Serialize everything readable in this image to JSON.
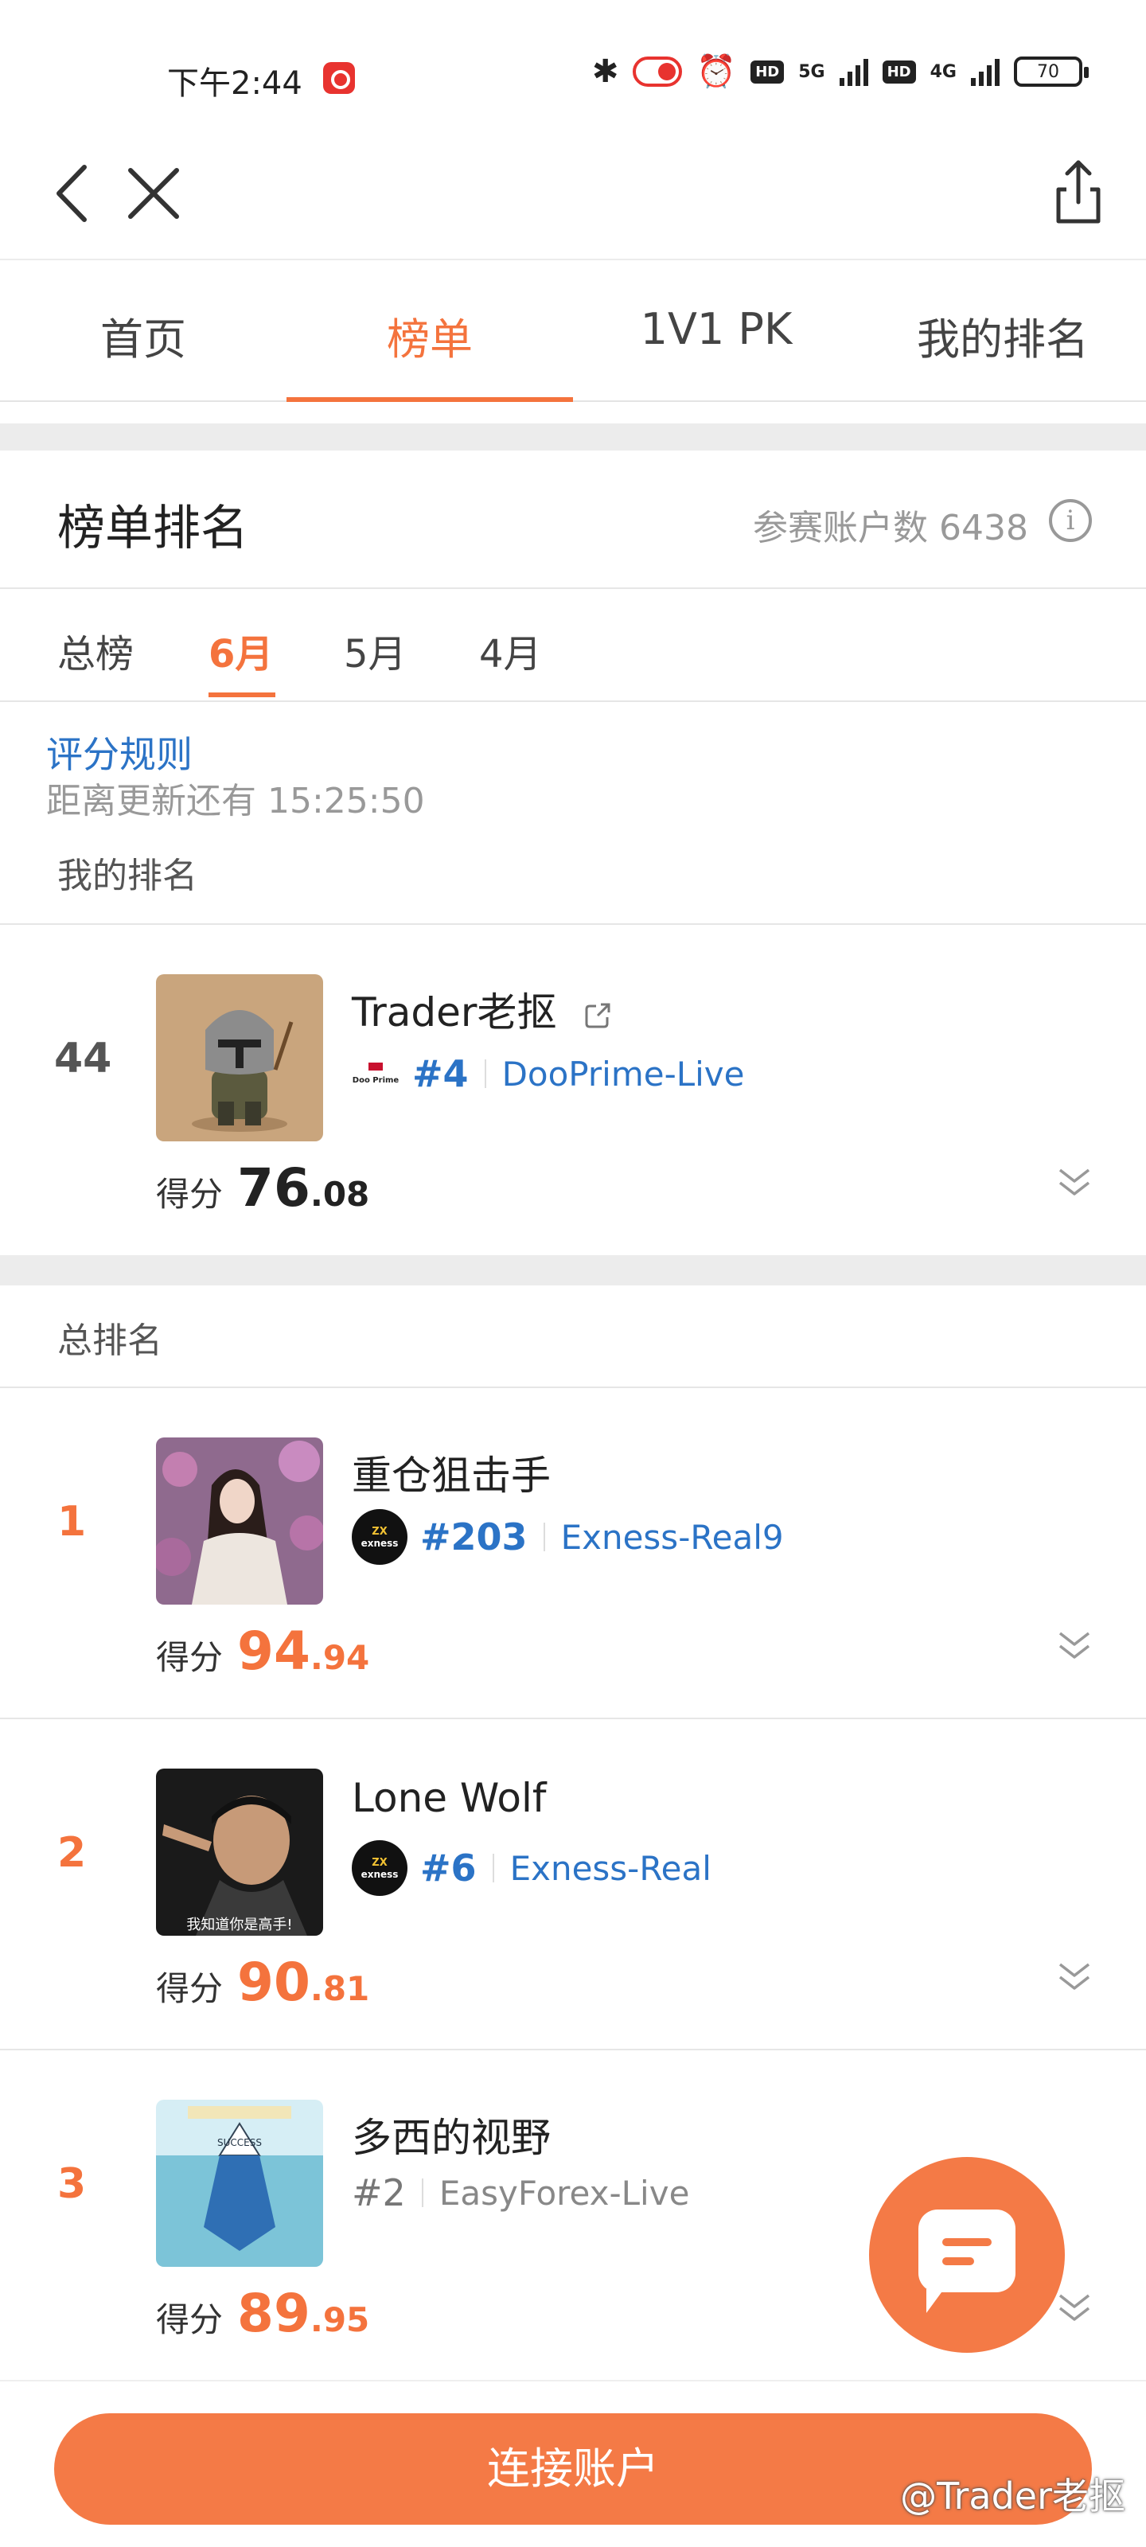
{
  "status_bar": {
    "time": "下午2:44",
    "net1": "5G",
    "net2": "4G",
    "hd": "HD",
    "battery": "70"
  },
  "tabs": [
    "首页",
    "榜单",
    "1V1 PK",
    "我的排名"
  ],
  "active_tab": 1,
  "section": {
    "title": "榜单排名",
    "participants": "参赛账户数 6438",
    "info_glyph": "i"
  },
  "month_tabs": [
    "总榜",
    "6月",
    "5月",
    "4月"
  ],
  "rules_link": "评分规则",
  "update_text": "距离更新还有 15:25:50",
  "my_rank_label": "我的排名",
  "my_rank": {
    "rank": "44",
    "name": "Trader老抠",
    "broker_logo": "Doo Prime",
    "broker_rank": "#4",
    "broker": "DooPrime-Live",
    "score_label": "得分",
    "score_int": "76",
    "score_dec": ".08"
  },
  "total_rank_label": "总排名",
  "entries": [
    {
      "rank": "1",
      "name": "重仓狙击手",
      "broker_logo": "exness",
      "broker_rank": "#203",
      "broker": "Exness-Real9",
      "score_label": "得分",
      "score_int": "94",
      "score_dec": ".94"
    },
    {
      "rank": "2",
      "name": "Lone Wolf",
      "broker_logo": "exness",
      "broker_rank": "#6",
      "broker": "Exness-Real",
      "score_label": "得分",
      "score_int": "90",
      "score_dec": ".81",
      "avatar_caption": "我知道你是高手!"
    },
    {
      "rank": "3",
      "name": "多西的视野",
      "broker_rank": "#2",
      "broker": "EasyForex-Live",
      "score_label": "得分",
      "score_int": "89",
      "score_dec": ".95"
    }
  ],
  "connect_button": "连接账户",
  "watermark": "@Trader老抠",
  "colors": {
    "accent": "#f4733d",
    "link": "#2b73c6"
  }
}
